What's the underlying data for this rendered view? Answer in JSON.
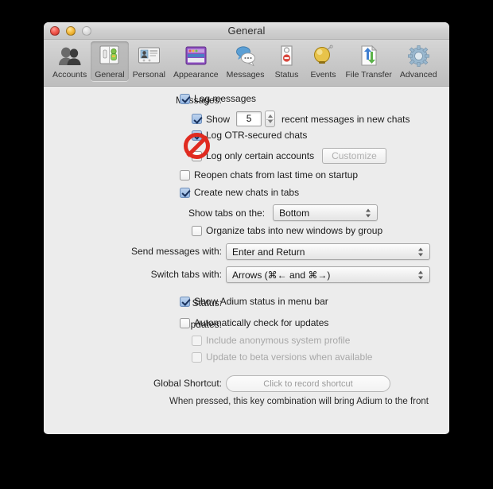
{
  "window": {
    "title": "General",
    "traffic_lights": [
      "close",
      "minimize",
      "zoom"
    ]
  },
  "toolbar": {
    "items": [
      {
        "label": "Accounts",
        "icon": "accounts-icon",
        "selected": false
      },
      {
        "label": "General",
        "icon": "general-icon",
        "selected": true
      },
      {
        "label": "Personal",
        "icon": "personal-icon",
        "selected": false
      },
      {
        "label": "Appearance",
        "icon": "appearance-icon",
        "selected": false
      },
      {
        "label": "Messages",
        "icon": "messages-icon",
        "selected": false
      },
      {
        "label": "Status",
        "icon": "status-icon",
        "selected": false
      },
      {
        "label": "Events",
        "icon": "events-icon",
        "selected": false
      },
      {
        "label": "File Transfer",
        "icon": "file-transfer-icon",
        "selected": false
      },
      {
        "label": "Advanced",
        "icon": "advanced-icon",
        "selected": false
      }
    ]
  },
  "labels": {
    "messages": "Messages:",
    "send_messages_with": "Send messages with:",
    "switch_tabs_with": "Switch tabs with:",
    "status": "Status:",
    "updates": "Updates:",
    "global_shortcut": "Global Shortcut:",
    "show_tabs_on_the": "Show tabs on the:"
  },
  "checkboxes": {
    "log_messages": {
      "label": "Log messages",
      "checked": true,
      "disabled": false
    },
    "show_recent": {
      "label_before": "Show",
      "label_after": "recent messages in new chats",
      "checked": true,
      "disabled": false
    },
    "log_otr": {
      "label": "Log OTR-secured chats",
      "checked": true,
      "disabled": false
    },
    "log_only_certain": {
      "label": "Log only certain accounts",
      "checked": false,
      "disabled": false
    },
    "reopen_chats": {
      "label": "Reopen chats from last time on startup",
      "checked": false,
      "disabled": false
    },
    "create_new_tabs": {
      "label": "Create new chats in tabs",
      "checked": true,
      "disabled": false
    },
    "organize_tabs": {
      "label": "Organize tabs into new windows by group",
      "checked": false,
      "disabled": false
    },
    "show_adium_status": {
      "label": "Show Adium status in menu bar",
      "checked": true,
      "disabled": false
    },
    "auto_check_updates": {
      "label": "Automatically check for updates",
      "checked": false,
      "disabled": false
    },
    "anon_profile": {
      "label": "Include anonymous system profile",
      "checked": false,
      "disabled": true
    },
    "beta_versions": {
      "label": "Update to beta versions when available",
      "checked": false,
      "disabled": true
    }
  },
  "fields": {
    "recent_messages_count": "5"
  },
  "buttons": {
    "customize": {
      "label": "Customize",
      "disabled": true
    }
  },
  "selects": {
    "show_tabs_on_the": {
      "value": "Bottom"
    },
    "send_messages_with": {
      "value": "Enter and Return"
    },
    "switch_tabs_with": {
      "value": "Arrows (⌘← and ⌘→)"
    }
  },
  "shortcut_recorder": {
    "placeholder": "Click to record shortcut"
  },
  "hint_text": "When pressed, this key combination will bring Adium to the front",
  "annotation": {
    "type": "prohibition-circle",
    "target": "log-otr-secured-chats-checkbox",
    "color": "#e02b20"
  }
}
